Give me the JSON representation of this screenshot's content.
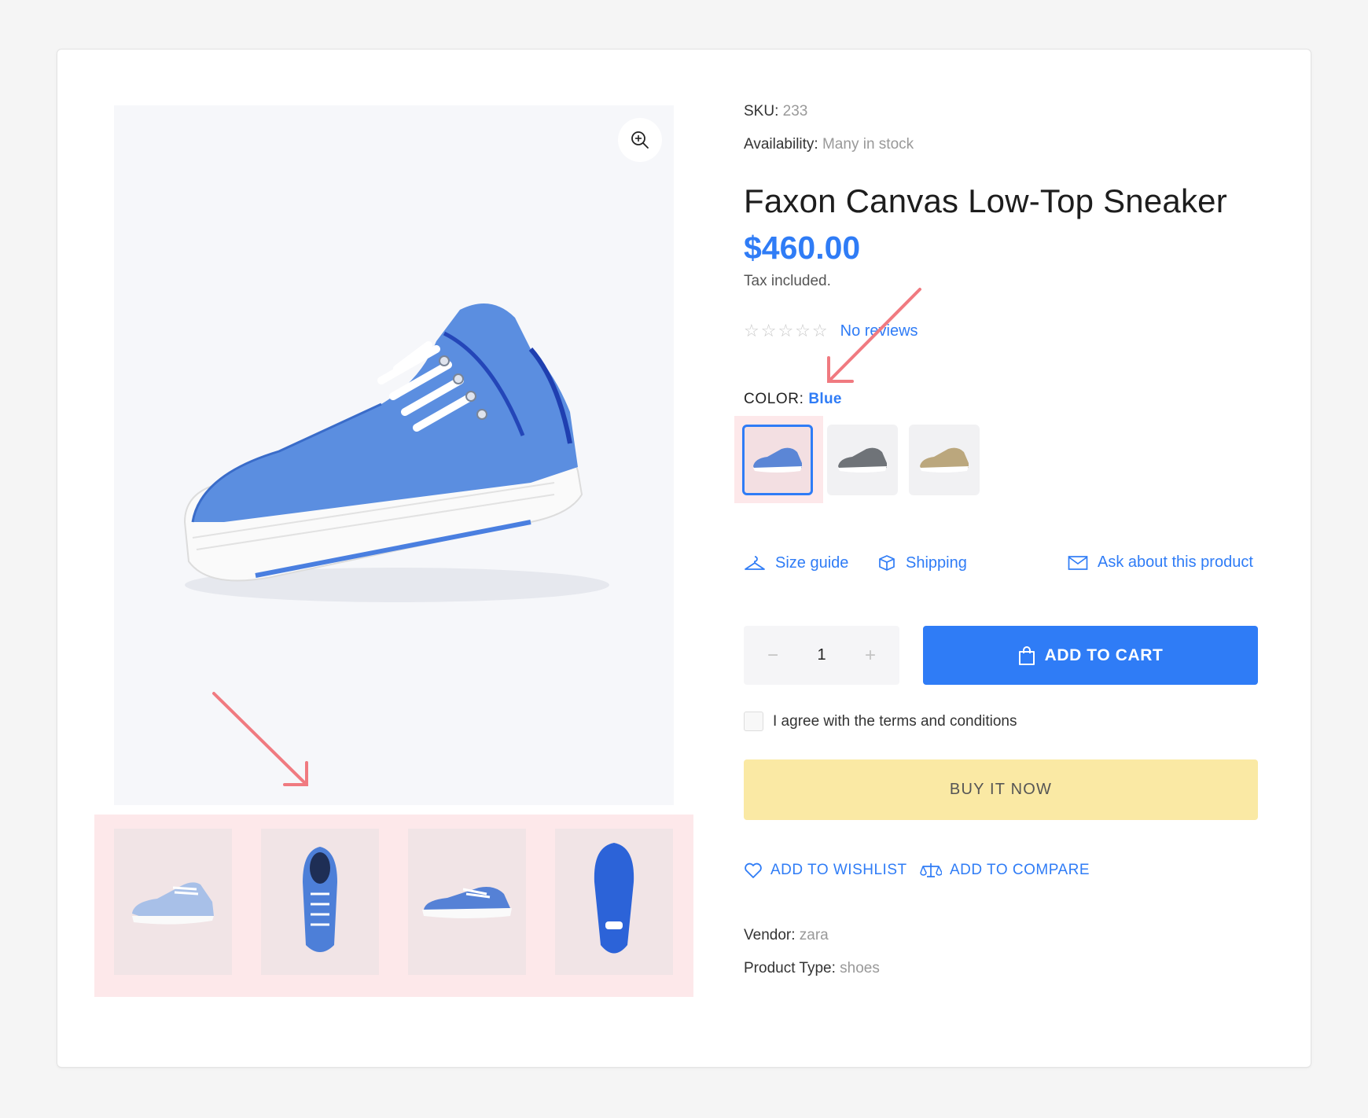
{
  "product": {
    "sku_label": "SKU:",
    "sku": "233",
    "availability_label": "Availability:",
    "availability": "Many in stock",
    "title": "Faxon Canvas Low-Top Sneaker",
    "price": "$460.00",
    "tax_note": "Tax included.",
    "stars": "☆☆☆☆☆",
    "rating_stars": 0,
    "reviews_text": "No reviews",
    "color_label": "COLOR:",
    "color_value": "Blue",
    "swatches": [
      {
        "name": "Blue",
        "color": "#5b86d6",
        "selected": true
      },
      {
        "name": "Grey",
        "color": "#6f7378",
        "selected": false
      },
      {
        "name": "Beige",
        "color": "#bba77d",
        "selected": false
      }
    ],
    "links": {
      "size_guide": "Size guide",
      "shipping": "Shipping",
      "ask": "Ask about this product"
    },
    "quantity": {
      "minus": "−",
      "value": "1",
      "plus": "+"
    },
    "add_to_cart": "ADD TO CART",
    "agree_text": "I agree with the terms and conditions",
    "buy_now": "BUY IT NOW",
    "wishlist": "ADD TO WISHLIST",
    "compare": "ADD TO COMPARE",
    "vendor_label": "Vendor:",
    "vendor": "zara",
    "type_label": "Product Type:",
    "type": "shoes"
  },
  "gallery": {
    "zoom_icon": "zoom-in-icon",
    "thumbnails": [
      "side-view",
      "top-view",
      "profile-view",
      "sole-view"
    ]
  },
  "colors": {
    "accent": "#2f7cf6",
    "buy_now_bg": "#fae9a4",
    "highlight": "#fde8ea",
    "annotation_arrow": "#f07a80"
  }
}
